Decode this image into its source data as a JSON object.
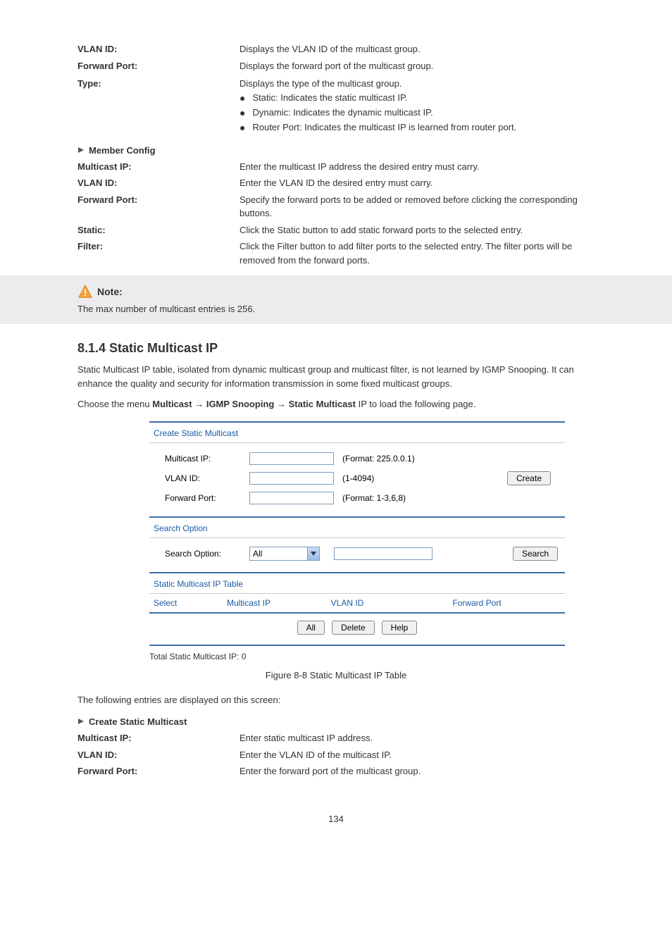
{
  "top_fields": [
    {
      "label": "VLAN ID:",
      "desc": "Displays the VLAN ID of the multicast group."
    },
    {
      "label": "Forward Port:",
      "desc": "Displays the forward port of the multicast group."
    }
  ],
  "type_field": {
    "label": "Type:",
    "intro": "Displays the type of the multicast group.",
    "bullets": [
      "Static: Indicates the static multicast IP.",
      "Dynamic: Indicates the dynamic multicast IP.",
      "Router Port: Indicates the multicast IP is learned from router port."
    ]
  },
  "member_config": {
    "heading": "Member Config",
    "rows": [
      {
        "label": "Multicast IP:",
        "desc": "Enter the multicast IP address the desired entry must carry."
      },
      {
        "label": "VLAN ID:",
        "desc": "Enter the VLAN ID the desired entry must carry."
      },
      {
        "label": "Forward Port:",
        "desc": "Specify the forward ports to be added or removed before clicking the corresponding buttons."
      },
      {
        "label": "Static:",
        "desc": "Click the Static button to add static forward ports to the selected entry."
      },
      {
        "label": "Filter:",
        "desc": "Click the Filter button to add filter ports to the selected entry. The filter ports will be removed from the forward ports."
      }
    ]
  },
  "note": {
    "title": "Note:",
    "body": "The max number of multicast entries is 256."
  },
  "section_number": "8.1.4 Static Multicast IP",
  "para1": "Static Multicast IP table, isolated from dynamic multicast group and multicast filter, is not learned by IGMP Snooping. It can enhance the quality and security for information transmission in some fixed multicast groups.",
  "nav": {
    "prefix": "Choose the menu ",
    "path1": "Multicast",
    "arrow": "→",
    "path2": "IGMP Snooping",
    "path3": "Static Multicast",
    "suffix": " IP to load the following page."
  },
  "ui": {
    "create_title": "Create Static Multicast",
    "multicast_ip": "Multicast IP:",
    "multicast_ip_hint": "(Format: 225.0.0.1)",
    "vlan_id": "VLAN ID:",
    "vlan_id_hint": "(1-4094)",
    "forward_port": "Forward Port:",
    "forward_port_hint": "(Format: 1-3,6,8)",
    "create_btn": "Create",
    "search_title": "Search Option",
    "search_label": "Search Option:",
    "search_sel": "All",
    "search_btn": "Search",
    "table_title": "Static Multicast IP Table",
    "th_select": "Select",
    "th_mip": "Multicast IP",
    "th_vlan": "VLAN ID",
    "th_fwd": "Forward Port",
    "btn_all": "All",
    "btn_delete": "Delete",
    "btn_help": "Help",
    "total": "Total Static Multicast IP: 0"
  },
  "fig_caption": "Figure 8-8 Static Multicast IP Table",
  "desc_heading": "The following entries are displayed on this screen:",
  "create_static": {
    "heading": "Create Static Multicast",
    "rows": [
      {
        "label": "Multicast IP:",
        "desc": "Enter static multicast IP address."
      },
      {
        "label": "VLAN ID:",
        "desc": "Enter the VLAN ID of the multicast IP."
      },
      {
        "label": "Forward Port:",
        "desc": "Enter the forward port of the multicast group."
      }
    ]
  },
  "page_num": "134"
}
